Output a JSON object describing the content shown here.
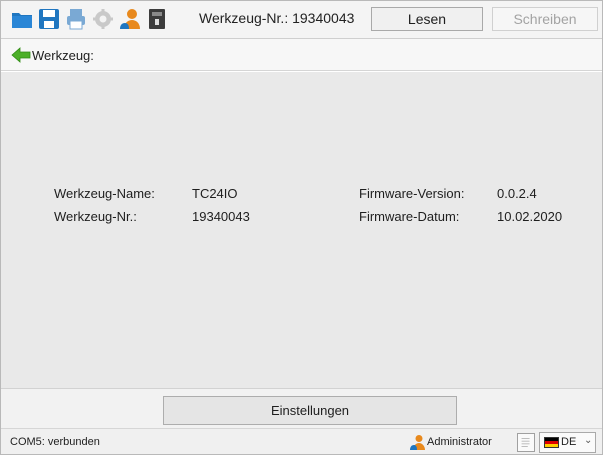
{
  "toolbar": {
    "icons": [
      "folder-icon",
      "save-icon",
      "print-icon",
      "settings-icon",
      "user-icon",
      "device-icon"
    ],
    "tool_number": "Werkzeug-Nr.: 19340043",
    "read_label": "Lesen",
    "write_label": "Schreiben"
  },
  "breadcrumb": {
    "label": "Werkzeug:"
  },
  "info": {
    "tool_name_label": "Werkzeug-Name:",
    "tool_name_value": "TC24IO",
    "tool_no_label": "Werkzeug-Nr.:",
    "tool_no_value": "19340043",
    "fw_version_label": "Firmware-Version:",
    "fw_version_value": "0.0.2.4",
    "fw_date_label": "Firmware-Datum:",
    "fw_date_value": "10.02.2020"
  },
  "actions": {
    "settings_label": "Einstellungen"
  },
  "statusbar": {
    "connection": "COM5: verbunden",
    "user": "Administrator",
    "language": "DE"
  },
  "colors": {
    "accent_blue": "#1f76c0",
    "back_green": "#4caf28",
    "user_orange": "#e8891d"
  }
}
